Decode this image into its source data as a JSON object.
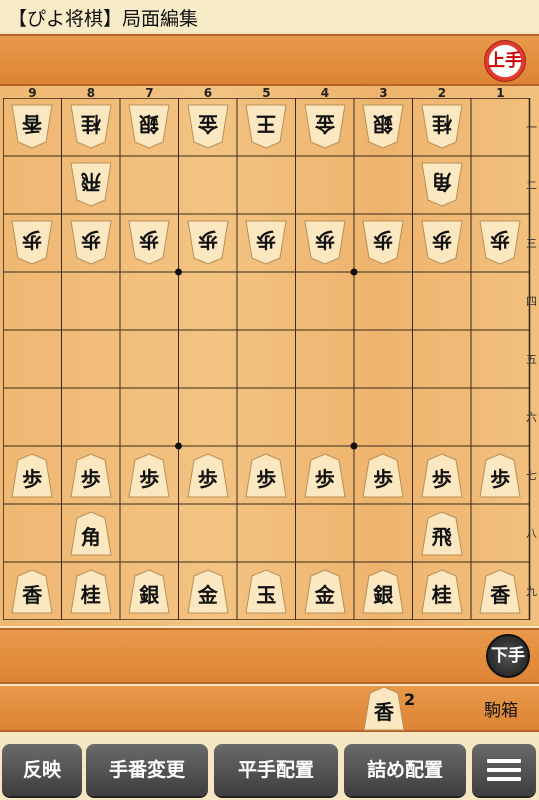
{
  "app": {
    "title": "【ぴよ将棋】局面編集"
  },
  "board": {
    "col_labels": [
      "9",
      "8",
      "7",
      "6",
      "5",
      "4",
      "3",
      "2",
      "1"
    ],
    "row_labels": [
      "一",
      "二",
      "三",
      "四",
      "五",
      "六",
      "七",
      "八",
      "九"
    ],
    "pieces": [
      {
        "c": 0,
        "r": 0,
        "t": "香",
        "o": "gote"
      },
      {
        "c": 1,
        "r": 0,
        "t": "桂",
        "o": "gote"
      },
      {
        "c": 2,
        "r": 0,
        "t": "銀",
        "o": "gote"
      },
      {
        "c": 3,
        "r": 0,
        "t": "金",
        "o": "gote"
      },
      {
        "c": 4,
        "r": 0,
        "t": "王",
        "o": "gote"
      },
      {
        "c": 5,
        "r": 0,
        "t": "金",
        "o": "gote"
      },
      {
        "c": 6,
        "r": 0,
        "t": "銀",
        "o": "gote"
      },
      {
        "c": 7,
        "r": 0,
        "t": "桂",
        "o": "gote"
      },
      {
        "c": 1,
        "r": 1,
        "t": "飛",
        "o": "gote"
      },
      {
        "c": 7,
        "r": 1,
        "t": "角",
        "o": "gote"
      },
      {
        "c": 0,
        "r": 2,
        "t": "歩",
        "o": "gote"
      },
      {
        "c": 1,
        "r": 2,
        "t": "歩",
        "o": "gote"
      },
      {
        "c": 2,
        "r": 2,
        "t": "歩",
        "o": "gote"
      },
      {
        "c": 3,
        "r": 2,
        "t": "歩",
        "o": "gote"
      },
      {
        "c": 4,
        "r": 2,
        "t": "歩",
        "o": "gote"
      },
      {
        "c": 5,
        "r": 2,
        "t": "歩",
        "o": "gote"
      },
      {
        "c": 6,
        "r": 2,
        "t": "歩",
        "o": "gote"
      },
      {
        "c": 7,
        "r": 2,
        "t": "歩",
        "o": "gote"
      },
      {
        "c": 8,
        "r": 2,
        "t": "歩",
        "o": "gote"
      },
      {
        "c": 0,
        "r": 6,
        "t": "歩",
        "o": "sente"
      },
      {
        "c": 1,
        "r": 6,
        "t": "歩",
        "o": "sente"
      },
      {
        "c": 2,
        "r": 6,
        "t": "歩",
        "o": "sente"
      },
      {
        "c": 3,
        "r": 6,
        "t": "歩",
        "o": "sente"
      },
      {
        "c": 4,
        "r": 6,
        "t": "歩",
        "o": "sente"
      },
      {
        "c": 5,
        "r": 6,
        "t": "歩",
        "o": "sente"
      },
      {
        "c": 6,
        "r": 6,
        "t": "歩",
        "o": "sente"
      },
      {
        "c": 7,
        "r": 6,
        "t": "歩",
        "o": "sente"
      },
      {
        "c": 8,
        "r": 6,
        "t": "歩",
        "o": "sente"
      },
      {
        "c": 1,
        "r": 7,
        "t": "角",
        "o": "sente"
      },
      {
        "c": 7,
        "r": 7,
        "t": "飛",
        "o": "sente"
      },
      {
        "c": 0,
        "r": 8,
        "t": "香",
        "o": "sente"
      },
      {
        "c": 1,
        "r": 8,
        "t": "桂",
        "o": "sente"
      },
      {
        "c": 2,
        "r": 8,
        "t": "銀",
        "o": "sente"
      },
      {
        "c": 3,
        "r": 8,
        "t": "金",
        "o": "sente"
      },
      {
        "c": 4,
        "r": 8,
        "t": "玉",
        "o": "sente"
      },
      {
        "c": 5,
        "r": 8,
        "t": "金",
        "o": "sente"
      },
      {
        "c": 6,
        "r": 8,
        "t": "銀",
        "o": "sente"
      },
      {
        "c": 7,
        "r": 8,
        "t": "桂",
        "o": "sente"
      },
      {
        "c": 8,
        "r": 8,
        "t": "香",
        "o": "sente"
      }
    ]
  },
  "gote": {
    "label": "上手"
  },
  "sente": {
    "label": "下手"
  },
  "komabako": {
    "label": "駒箱",
    "piece": "香",
    "count": "2"
  },
  "toolbar": {
    "reflect": "反映",
    "change_turn": "手番変更",
    "hirate": "平手配置",
    "tsume": "詰め配置",
    "menu_icon": "hamburger-menu-icon"
  },
  "colors": {
    "board": "#f3c382",
    "hand": "#e28d3c",
    "button": "#4a4a4a",
    "gote_badge": "#e23a2c"
  }
}
